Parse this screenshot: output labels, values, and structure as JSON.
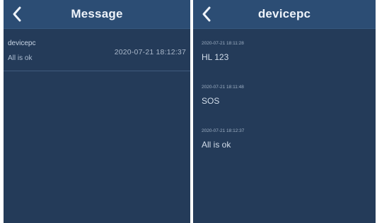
{
  "left_screen": {
    "header": {
      "title": "Message",
      "back_icon": "chevron-left-icon"
    },
    "messages": [
      {
        "sender": "devicepc",
        "preview": "All is ok",
        "time": "2020-07-21 18:12:37"
      }
    ]
  },
  "right_screen": {
    "header": {
      "title": "devicepc",
      "back_icon": "chevron-left-icon"
    },
    "chat": [
      {
        "time": "2020-07-21 18:11:28",
        "text": "HL 123"
      },
      {
        "time": "2020-07-21 18:11:48",
        "text": "SOS"
      },
      {
        "time": "2020-07-21 18:12:37",
        "text": "All is ok"
      }
    ]
  },
  "colors": {
    "background": "#243b59",
    "header": "#2c4d74",
    "text": "#eef3fa"
  }
}
